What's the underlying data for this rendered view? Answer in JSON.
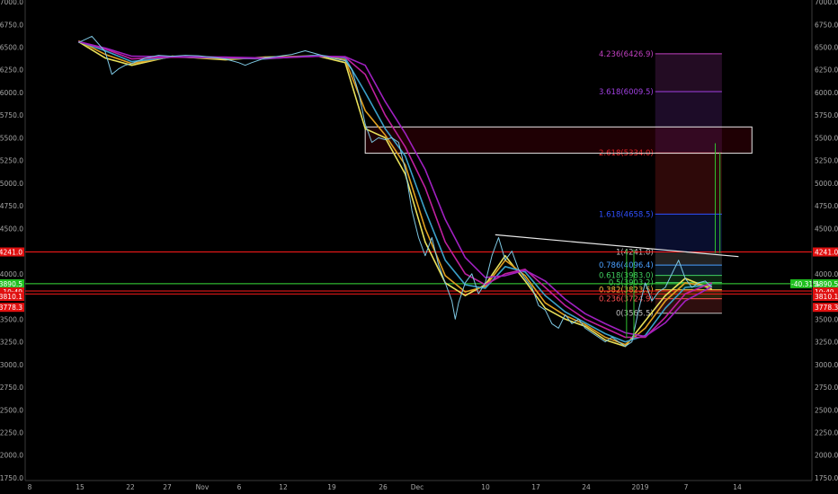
{
  "chart_data": {
    "type": "line",
    "x_tick_labels": [
      "8",
      "15",
      "22",
      "27",
      "Nov",
      "6",
      "12",
      "19",
      "26",
      "Dec",
      "10",
      "17",
      "24",
      "2019",
      "7",
      "14"
    ],
    "y_ticks": [
      7000.0,
      6750.0,
      6500.0,
      6250.0,
      6000.0,
      5750.0,
      5500.0,
      5250.0,
      5000.0,
      4750.0,
      4500.0,
      4250.0,
      4000.0,
      3750.0,
      3500.0,
      3250.0,
      3000.0,
      2750.0,
      2500.0,
      2250.0,
      2000.0,
      1750.0
    ],
    "ylim": [
      1720,
      7020
    ],
    "grid": false,
    "price_series": {
      "name": "",
      "color": "#7ec8e3",
      "points": [
        [
          8,
          6550
        ],
        [
          10,
          6620
        ],
        [
          12,
          6450
        ],
        [
          13,
          6200
        ],
        [
          14,
          6260
        ],
        [
          15,
          6300
        ],
        [
          16,
          6320
        ],
        [
          18,
          6380
        ],
        [
          20,
          6410
        ],
        [
          22,
          6400
        ],
        [
          24,
          6410
        ],
        [
          26,
          6405
        ],
        [
          28,
          6390
        ],
        [
          30,
          6370
        ],
        [
          32,
          6330
        ],
        [
          33,
          6300
        ],
        [
          34,
          6330
        ],
        [
          36,
          6380
        ],
        [
          38,
          6400
        ],
        [
          40,
          6420
        ],
        [
          42,
          6460
        ],
        [
          44,
          6420
        ],
        [
          46,
          6380
        ],
        [
          48,
          6350
        ],
        [
          49,
          6250
        ],
        [
          50,
          6000
        ],
        [
          51,
          5650
        ],
        [
          52,
          5450
        ],
        [
          53,
          5500
        ],
        [
          54,
          5480
        ],
        [
          55,
          5500
        ],
        [
          56,
          5450
        ],
        [
          57,
          5150
        ],
        [
          58,
          4700
        ],
        [
          59,
          4400
        ],
        [
          60,
          4200
        ],
        [
          61,
          4400
        ],
        [
          62,
          4100
        ],
        [
          63,
          3900
        ],
        [
          64,
          3700
        ],
        [
          64.5,
          3500
        ],
        [
          65,
          3680
        ],
        [
          66,
          3900
        ],
        [
          67,
          4000
        ],
        [
          68,
          3780
        ],
        [
          69,
          3900
        ],
        [
          70,
          4200
        ],
        [
          71,
          4400
        ],
        [
          72,
          4150
        ],
        [
          73,
          4250
        ],
        [
          74,
          4050
        ],
        [
          75,
          3950
        ],
        [
          76,
          3850
        ],
        [
          77,
          3650
        ],
        [
          78,
          3600
        ],
        [
          79,
          3450
        ],
        [
          80,
          3400
        ],
        [
          81,
          3550
        ],
        [
          82,
          3450
        ],
        [
          83,
          3500
        ],
        [
          84,
          3400
        ],
        [
          85,
          3350
        ],
        [
          86,
          3300
        ],
        [
          87,
          3250
        ],
        [
          88,
          3300
        ],
        [
          89,
          3250
        ],
        [
          90,
          3200
        ],
        [
          91,
          3250
        ],
        [
          92,
          3600
        ],
        [
          93,
          3900
        ],
        [
          94,
          3700
        ],
        [
          95,
          3800
        ],
        [
          96,
          3850
        ],
        [
          97,
          4000
        ],
        [
          98,
          4150
        ],
        [
          99,
          3950
        ],
        [
          100,
          3850
        ],
        [
          101,
          3900
        ],
        [
          102,
          3920
        ],
        [
          103,
          3850
        ]
      ]
    },
    "ma_series": [
      {
        "name": "",
        "color": "#e8e05a",
        "points": [
          [
            8,
            6560
          ],
          [
            12,
            6380
          ],
          [
            16,
            6300
          ],
          [
            22,
            6400
          ],
          [
            30,
            6360
          ],
          [
            36,
            6390
          ],
          [
            44,
            6400
          ],
          [
            48,
            6330
          ],
          [
            51,
            5600
          ],
          [
            54,
            5500
          ],
          [
            57,
            5100
          ],
          [
            60,
            4350
          ],
          [
            63,
            3900
          ],
          [
            66,
            3760
          ],
          [
            69,
            3880
          ],
          [
            72,
            4200
          ],
          [
            75,
            3920
          ],
          [
            78,
            3620
          ],
          [
            81,
            3500
          ],
          [
            84,
            3420
          ],
          [
            87,
            3270
          ],
          [
            90,
            3200
          ],
          [
            93,
            3480
          ],
          [
            96,
            3760
          ],
          [
            99,
            3950
          ],
          [
            103,
            3830
          ]
        ]
      },
      {
        "name": "",
        "color": "#e0a020",
        "points": [
          [
            8,
            6570
          ],
          [
            12,
            6420
          ],
          [
            16,
            6320
          ],
          [
            22,
            6395
          ],
          [
            30,
            6370
          ],
          [
            36,
            6380
          ],
          [
            44,
            6410
          ],
          [
            48,
            6360
          ],
          [
            51,
            5800
          ],
          [
            54,
            5530
          ],
          [
            57,
            5200
          ],
          [
            60,
            4500
          ],
          [
            63,
            3980
          ],
          [
            66,
            3800
          ],
          [
            69,
            3860
          ],
          [
            72,
            4150
          ],
          [
            75,
            3980
          ],
          [
            78,
            3680
          ],
          [
            81,
            3540
          ],
          [
            84,
            3440
          ],
          [
            87,
            3300
          ],
          [
            90,
            3220
          ],
          [
            93,
            3400
          ],
          [
            96,
            3700
          ],
          [
            99,
            3900
          ],
          [
            103,
            3860
          ]
        ]
      },
      {
        "name": "",
        "color": "#3aa0c8",
        "points": [
          [
            8,
            6560
          ],
          [
            12,
            6460
          ],
          [
            16,
            6340
          ],
          [
            22,
            6390
          ],
          [
            30,
            6380
          ],
          [
            36,
            6370
          ],
          [
            44,
            6410
          ],
          [
            48,
            6380
          ],
          [
            51,
            6000
          ],
          [
            54,
            5600
          ],
          [
            57,
            5300
          ],
          [
            60,
            4700
          ],
          [
            63,
            4150
          ],
          [
            66,
            3880
          ],
          [
            69,
            3840
          ],
          [
            72,
            4080
          ],
          [
            75,
            4020
          ],
          [
            78,
            3760
          ],
          [
            81,
            3580
          ],
          [
            84,
            3460
          ],
          [
            87,
            3340
          ],
          [
            90,
            3250
          ],
          [
            93,
            3320
          ],
          [
            96,
            3620
          ],
          [
            99,
            3850
          ],
          [
            103,
            3880
          ]
        ]
      },
      {
        "name": "",
        "color": "#c020a0",
        "points": [
          [
            8,
            6560
          ],
          [
            12,
            6480
          ],
          [
            16,
            6370
          ],
          [
            22,
            6390
          ],
          [
            30,
            6385
          ],
          [
            36,
            6375
          ],
          [
            44,
            6400
          ],
          [
            48,
            6390
          ],
          [
            51,
            6200
          ],
          [
            54,
            5750
          ],
          [
            57,
            5400
          ],
          [
            60,
            4950
          ],
          [
            63,
            4350
          ],
          [
            66,
            4000
          ],
          [
            69,
            3880
          ],
          [
            72,
            4000
          ],
          [
            75,
            4050
          ],
          [
            78,
            3850
          ],
          [
            81,
            3650
          ],
          [
            84,
            3500
          ],
          [
            87,
            3400
          ],
          [
            90,
            3300
          ],
          [
            93,
            3300
          ],
          [
            96,
            3520
          ],
          [
            99,
            3780
          ],
          [
            103,
            3900
          ]
        ]
      },
      {
        "name": "",
        "color": "#a020c0",
        "points": [
          [
            8,
            6560
          ],
          [
            12,
            6490
          ],
          [
            16,
            6400
          ],
          [
            22,
            6395
          ],
          [
            30,
            6390
          ],
          [
            36,
            6380
          ],
          [
            44,
            6400
          ],
          [
            48,
            6395
          ],
          [
            51,
            6300
          ],
          [
            54,
            5900
          ],
          [
            57,
            5550
          ],
          [
            60,
            5150
          ],
          [
            63,
            4600
          ],
          [
            66,
            4180
          ],
          [
            69,
            3960
          ],
          [
            72,
            3980
          ],
          [
            75,
            4040
          ],
          [
            78,
            3920
          ],
          [
            81,
            3720
          ],
          [
            84,
            3560
          ],
          [
            87,
            3450
          ],
          [
            90,
            3350
          ],
          [
            93,
            3310
          ],
          [
            96,
            3460
          ],
          [
            99,
            3700
          ],
          [
            103,
            3860
          ]
        ]
      }
    ],
    "resistance_zone": {
      "x_start": 51,
      "x_end": 109,
      "y_low": 5330,
      "y_high": 5620
    },
    "trendline": {
      "points": [
        [
          70.5,
          4430
        ],
        [
          107,
          4190
        ]
      ],
      "color": "#e8e8e8"
    },
    "horizontal_lines": [
      {
        "price": 4241.0,
        "color": "#ff1a1a"
      },
      {
        "price": 3890.5,
        "color": "#3adf3a"
      },
      {
        "price": 3810.1,
        "color": "#ff1a1a"
      },
      {
        "price": 3778.3,
        "color": "#ff1a1a"
      }
    ],
    "green_vertical_lines": [
      {
        "x": 90.2,
        "y_bottom": 3290,
        "y_top": 4270
      },
      {
        "x": 91.3,
        "y_bottom": 3290,
        "y_top": 4270
      },
      {
        "x": 103.5,
        "y_bottom": 4230,
        "y_top": 5440
      },
      {
        "x": 104.2,
        "y_bottom": 4230,
        "y_top": 5340
      }
    ],
    "fibonacci": {
      "x_start": 94.5,
      "x_end": 104.5,
      "levels": [
        {
          "label": "4.236(6426.9)",
          "price": 6426.9,
          "color": "#c040c0"
        },
        {
          "label": "3.618(6009.5)",
          "price": 6009.5,
          "color": "#a040e0"
        },
        {
          "label": "2.618(5334.0)",
          "price": 5334.0,
          "color": "#ff3030"
        },
        {
          "label": "1.618(4658.5)",
          "price": 4658.5,
          "color": "#3050ff"
        },
        {
          "label": "1(4241.0)",
          "price": 4241.0,
          "color": "#c0c0c0"
        },
        {
          "label": "0.786(4096.4)",
          "price": 4096.4,
          "color": "#4aa0ff"
        },
        {
          "label": "0.618(3983.0)",
          "price": 3983.0,
          "color": "#40d060"
        },
        {
          "label": "0.5(3903.2)",
          "price": 3903.2,
          "color": "#40d060"
        },
        {
          "label": "0.382(3823.5)",
          "price": 3823.5,
          "color": "#ffc040"
        },
        {
          "label": "0.236(3724.9)",
          "price": 3724.9,
          "color": "#ff5050"
        },
        {
          "label": "0(3565.5)",
          "price": 3565.5,
          "color": "#c0c0c0"
        }
      ]
    },
    "right_axis_tags": [
      {
        "text": "4241.0",
        "price": 4241.0,
        "bg": "#e01010"
      },
      {
        "text": "3890.5",
        "price": 3890.5,
        "bg": "#20c020"
      },
      {
        "text": "10:49",
        "price": 3800,
        "bg": "#e01010"
      },
      {
        "text": "3810.1",
        "price": 3750,
        "bg": "#e01010"
      },
      {
        "text": "3778.3",
        "price": 3630,
        "bg": "#e01010"
      }
    ],
    "left_axis_tags": [
      {
        "text": "4241.0",
        "price": 4241.0,
        "bg": "#e01010"
      },
      {
        "text": "3890.5",
        "price": 3890.5,
        "bg": "#20c020"
      },
      {
        "text": "10:49",
        "price": 3800,
        "bg": "#e01010"
      },
      {
        "text": "3810.1",
        "price": 3750,
        "bg": "#e01010"
      },
      {
        "text": "3778.3",
        "price": 3630,
        "bg": "#e01010"
      }
    ],
    "percent_tag": {
      "text": "-40.31%",
      "price": 3890.5,
      "bg": "#20c020"
    }
  }
}
